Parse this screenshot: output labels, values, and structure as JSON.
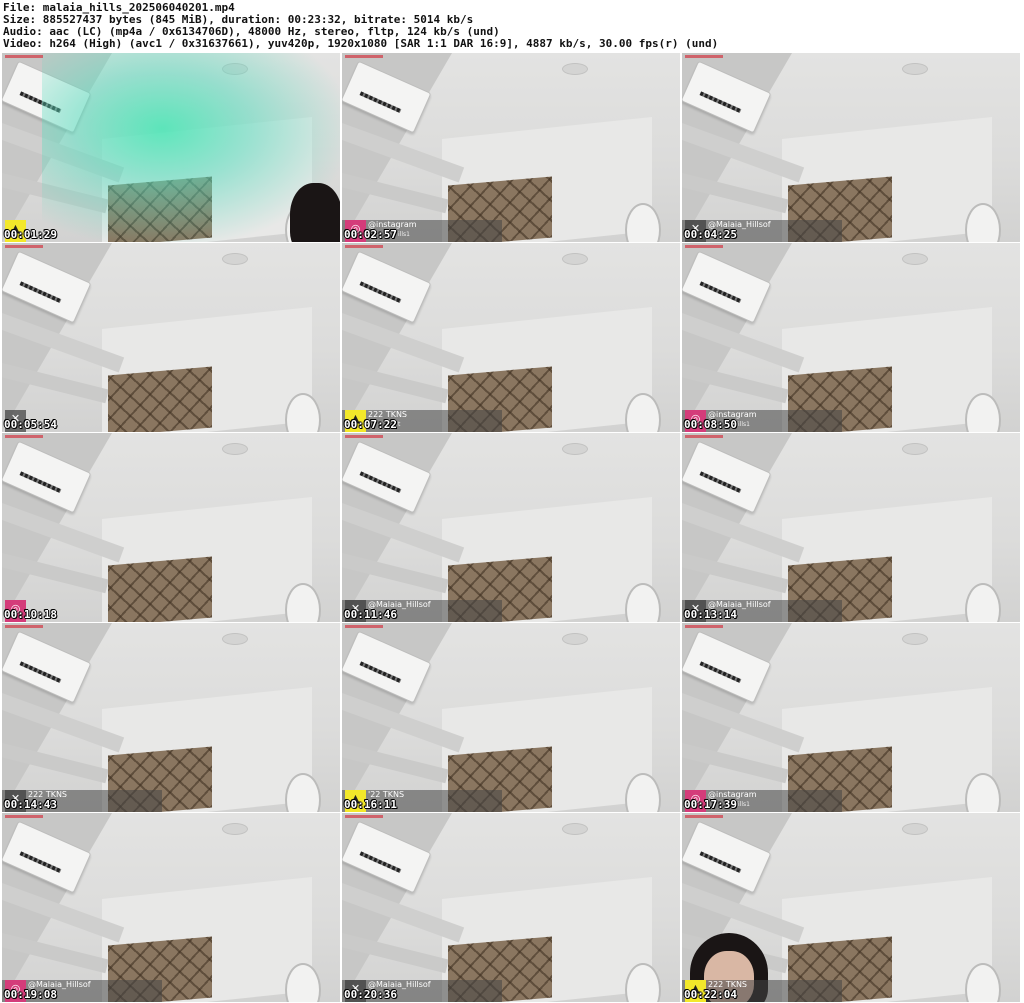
{
  "header": {
    "file": "File: malaia_hills_202506040201.mp4",
    "size": "Size: 885527437 bytes (845 MiB), duration: 00:23:32, bitrate: 5014 kb/s",
    "audio": "Audio: aac (LC) (mp4a / 0x6134706D), 48000 Hz, stereo, fltp, 124 kb/s (und)",
    "video": "Video: h264 (High) (avc1 / 0x31637661), yuv420p, 1920x1080 [SAR 1:1 DAR 16:9], 4887 kb/s, 30.00 fps(r) (und)"
  },
  "frames": [
    {
      "time": "00:01:29",
      "badge": "yellow",
      "text": "",
      "sub": "",
      "variant": "glow"
    },
    {
      "time": "00:02:57",
      "badge": "pink",
      "text": "@instagram",
      "sub": "ills1",
      "variant": "room"
    },
    {
      "time": "00:04:25",
      "badge": "dark",
      "text": "@Malaia_Hillsof",
      "sub": "",
      "variant": "room"
    },
    {
      "time": "00:05:54",
      "badge": "dark",
      "text": "",
      "sub": "",
      "variant": "room"
    },
    {
      "time": "00:07:22",
      "badge": "yellow",
      "text": "222 TKNS",
      "sub": "t",
      "variant": "room"
    },
    {
      "time": "00:08:50",
      "badge": "pink",
      "text": "@instagram",
      "sub": "ills1",
      "variant": "room"
    },
    {
      "time": "00:10:18",
      "badge": "pink",
      "text": "",
      "sub": "",
      "variant": "room"
    },
    {
      "time": "00:11:46",
      "badge": "dark",
      "text": "@Malaia_Hillsof",
      "sub": "",
      "variant": "room"
    },
    {
      "time": "00:13:14",
      "badge": "dark",
      "text": "@Malaia_Hillsof",
      "sub": "",
      "variant": "room"
    },
    {
      "time": "00:14:43",
      "badge": "dark",
      "text": "222 TKNS",
      "sub": "",
      "variant": "room"
    },
    {
      "time": "00:16:11",
      "badge": "yellow",
      "text": "'22 TKNS",
      "sub": "",
      "variant": "room"
    },
    {
      "time": "00:17:39",
      "badge": "pink",
      "text": "@instagram",
      "sub": "ills1",
      "variant": "room"
    },
    {
      "time": "00:19:08",
      "badge": "pink",
      "text": "@Malaia_Hillsof",
      "sub": "",
      "variant": "room"
    },
    {
      "time": "00:20:36",
      "badge": "dark",
      "text": "@Malaia_Hillsof",
      "sub": "",
      "variant": "room"
    },
    {
      "time": "00:22:04",
      "badge": "yellow",
      "text": "222 TKNS",
      "sub": "",
      "variant": "person"
    }
  ],
  "badge_colors": {
    "yellow": "#f3e82a",
    "pink": "#d43c7a",
    "dark": "#3c3c3c"
  },
  "badge_icons": {
    "yellow": "tip-icon",
    "pink": "instagram-icon",
    "dark": "x-icon"
  }
}
